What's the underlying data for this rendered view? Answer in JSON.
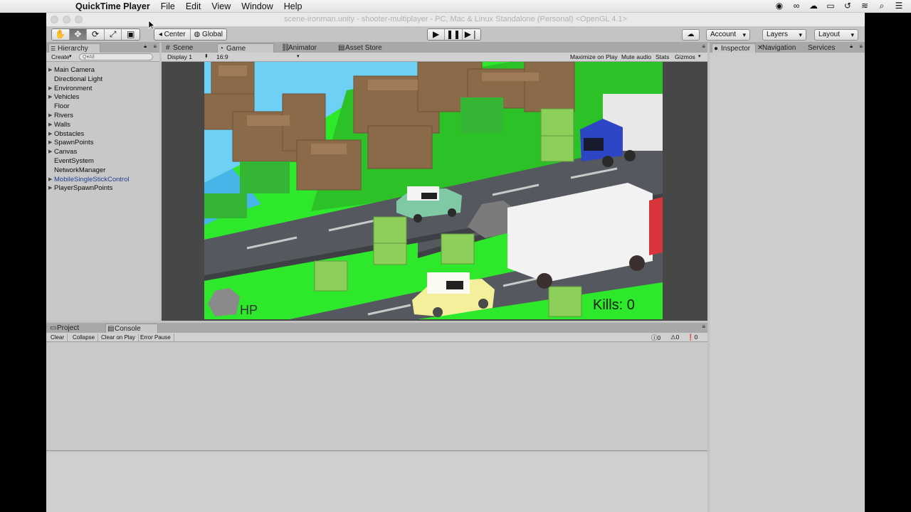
{
  "menubar": {
    "app_name": "QuickTime Player",
    "items": [
      "File",
      "Edit",
      "View",
      "Window",
      "Help"
    ]
  },
  "window": {
    "title": "scene-ironman.unity - shooter-multiplayer - PC, Mac & Linux Standalone (Personal) <OpenGL 4.1>"
  },
  "toolbar": {
    "center_label": "Center",
    "global_label": "Global",
    "account_label": "Account",
    "layers_label": "Layers",
    "layout_label": "Layout"
  },
  "hierarchy": {
    "tab_label": "Hierarchy",
    "create_label": "Create",
    "search_placeholder": "Q▾All",
    "items": [
      {
        "label": "Main Camera",
        "expandable": true
      },
      {
        "label": "Directional Light",
        "expandable": false
      },
      {
        "label": "Environment",
        "expandable": true
      },
      {
        "label": "Vehicles",
        "expandable": true
      },
      {
        "label": "Floor",
        "expandable": false
      },
      {
        "label": "Rivers",
        "expandable": true
      },
      {
        "label": "Walls",
        "expandable": true
      },
      {
        "label": "Obstacles",
        "expandable": true
      },
      {
        "label": "SpawnPoints",
        "expandable": true
      },
      {
        "label": "Canvas",
        "expandable": true
      },
      {
        "label": "EventSystem",
        "expandable": false
      },
      {
        "label": "NetworkManager",
        "expandable": false
      },
      {
        "label": "MobileSingleStickControl",
        "expandable": true
      },
      {
        "label": "PlayerSpawnPoints",
        "expandable": true
      }
    ]
  },
  "center_tabs": {
    "scene": "Scene",
    "game": "Game",
    "animator": "Animator",
    "asset_store": "Asset Store"
  },
  "game_bar": {
    "display": "Display 1",
    "aspect": "16:9",
    "maximize": "Maximize on Play",
    "mute": "Mute audio",
    "stats": "Stats",
    "gizmos": "Gizmos"
  },
  "game_hud": {
    "hp_label": "HP",
    "kills_label": "Kills: 0"
  },
  "right_tabs": {
    "inspector": "Inspector",
    "navigation": "Navigation",
    "services": "Services"
  },
  "bottom_tabs": {
    "project": "Project",
    "console": "Console"
  },
  "console_bar": {
    "clear": "Clear",
    "collapse": "Collapse",
    "clear_on_play": "Clear on Play",
    "error_pause": "Error Pause",
    "info_count": "0",
    "warn_count": "0",
    "error_count": "0"
  },
  "colors": {
    "grass": "#2ee82b",
    "road": "#55585e",
    "water": "#6fd0f5",
    "tree_brown": "#8b6a4a"
  }
}
